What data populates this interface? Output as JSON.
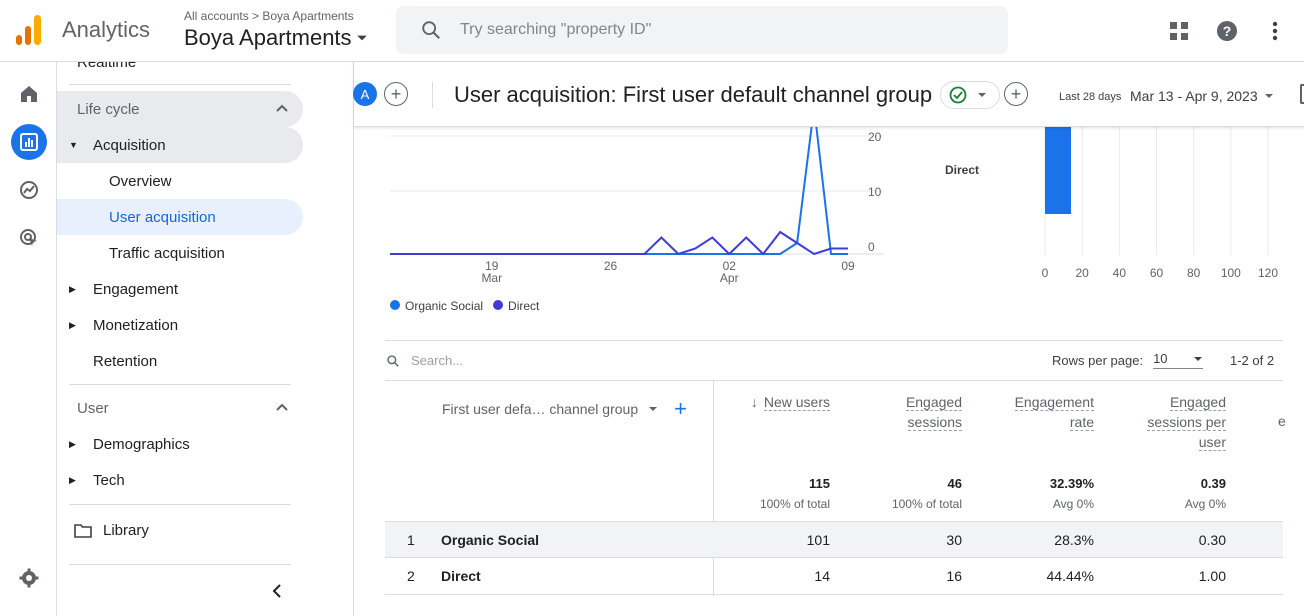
{
  "app": {
    "name": "Analytics",
    "breadcrumb": "All accounts > Boya Apartments",
    "account": "Boya Apartments"
  },
  "search": {
    "placeholder": "Try searching \"property ID\""
  },
  "top_icons": [
    "apps-icon",
    "help-icon",
    "more-vert-icon"
  ],
  "rail": [
    "home-icon",
    "reports-icon",
    "explore-icon",
    "advertising-icon",
    "settings-icon"
  ],
  "nav": {
    "cut_item": "Realtime",
    "lifecycle": "Life cycle",
    "acquisition": "Acquisition",
    "overview": "Overview",
    "user_acquisition": "User acquisition",
    "traffic_acquisition": "Traffic acquisition",
    "engagement": "Engagement",
    "monetization": "Monetization",
    "retention": "Retention",
    "user": "User",
    "demographics": "Demographics",
    "tech": "Tech",
    "library": "Library"
  },
  "header": {
    "avatar": "A",
    "title": "User acquisition: First user default channel group",
    "last_label": "Last 28 days",
    "date_range": "Mar 13 - Apr 9, 2023"
  },
  "colors": {
    "organic": "#1a73e8",
    "direct": "#3f3cd4",
    "accent": "#1a73e8"
  },
  "chart_data": [
    {
      "type": "line",
      "x": [
        "Mar 13",
        "Mar 14",
        "Mar 15",
        "Mar 16",
        "Mar 17",
        "Mar 18",
        "Mar 19",
        "Mar 20",
        "Mar 21",
        "Mar 22",
        "Mar 23",
        "Mar 24",
        "Mar 25",
        "Mar 26",
        "Mar 27",
        "Mar 28",
        "Mar 29",
        "Mar 30",
        "Mar 31",
        "Apr 01",
        "Apr 02",
        "Apr 03",
        "Apr 04",
        "Apr 05",
        "Apr 06",
        "Apr 07",
        "Apr 08",
        "Apr 09"
      ],
      "x_ticks": [
        {
          "day": "19",
          "month": "Mar"
        },
        {
          "day": "26",
          "month": ""
        },
        {
          "day": "02",
          "month": "Apr"
        },
        {
          "day": "09",
          "month": ""
        }
      ],
      "y_ticks": [
        "20",
        "10",
        "0"
      ],
      "series": [
        {
          "name": "Organic Social",
          "values": [
            0,
            0,
            0,
            0,
            0,
            0,
            0,
            0,
            0,
            0,
            0,
            0,
            0,
            0,
            0,
            0,
            0,
            0,
            0,
            0,
            0,
            0,
            0,
            0,
            2,
            60,
            0,
            0
          ]
        },
        {
          "name": "Direct",
          "values": [
            0,
            0,
            0,
            0,
            0,
            0,
            0,
            0,
            0,
            0,
            0,
            0,
            0,
            0,
            0,
            0,
            3,
            0,
            1,
            3,
            0,
            3,
            0,
            4,
            2,
            0,
            1,
            1
          ]
        }
      ]
    },
    {
      "type": "bar",
      "orientation": "horizontal",
      "categories": [
        "Direct"
      ],
      "values": [
        14
      ],
      "x_ticks": [
        "0",
        "20",
        "40",
        "60",
        "80",
        "100",
        "120"
      ],
      "xlim": [
        0,
        120
      ]
    }
  ],
  "table": {
    "search_placeholder": "Search...",
    "rows_per_page_label": "Rows per page:",
    "rows_per_page": "10",
    "range": "1-2 of 2",
    "dimension": "First user defa… channel group",
    "columns": [
      {
        "l1": "New users",
        "l2": "",
        "l3": "",
        "total": "115",
        "sub": "100% of total"
      },
      {
        "l1": "Engaged",
        "l2": "sessions",
        "l3": "",
        "total": "46",
        "sub": "100% of total"
      },
      {
        "l1": "Engagement",
        "l2": "rate",
        "l3": "",
        "total": "32.39%",
        "sub": "Avg 0%"
      },
      {
        "l1": "Engaged",
        "l2": "sessions per",
        "l3": "user",
        "total": "0.39",
        "sub": "Avg 0%"
      }
    ],
    "rows": [
      {
        "idx": "1",
        "name": "Organic Social",
        "v1": "101",
        "v2": "30",
        "v3": "28.3%",
        "v4": "0.30"
      },
      {
        "idx": "2",
        "name": "Direct",
        "v1": "14",
        "v2": "16",
        "v3": "44.44%",
        "v4": "1.00"
      }
    ]
  }
}
